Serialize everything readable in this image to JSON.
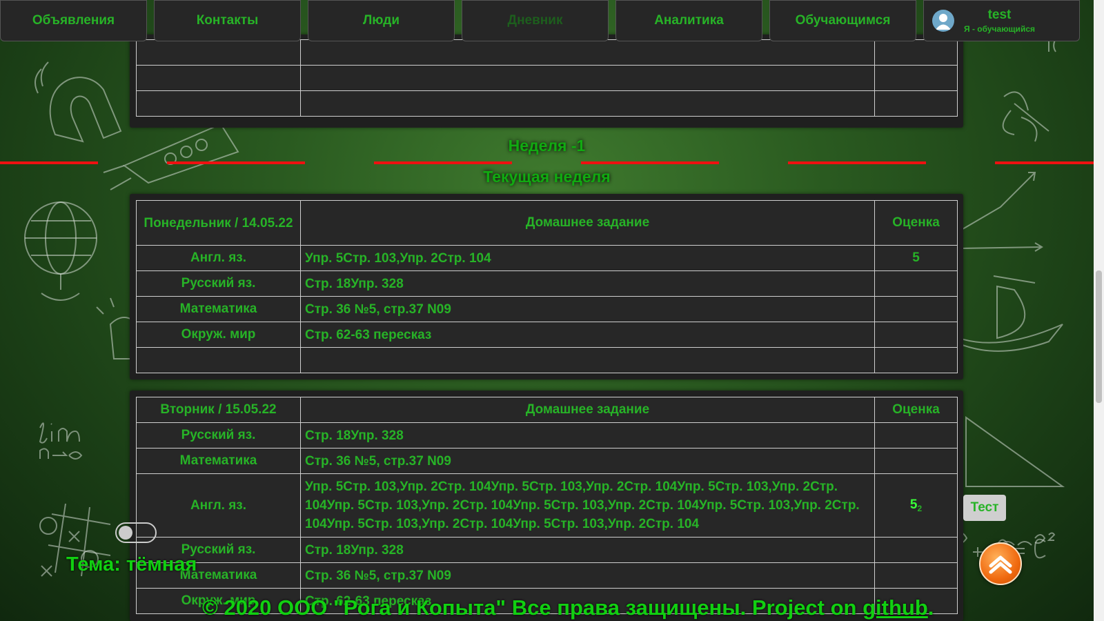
{
  "nav": {
    "items": [
      {
        "label": "Объявления"
      },
      {
        "label": "Контакты"
      },
      {
        "label": "Люди"
      },
      {
        "label": "Дневник",
        "active": true
      },
      {
        "label": "Аналитика"
      },
      {
        "label": "Обучающимся"
      }
    ],
    "user": {
      "name": "test",
      "role": "Я - обучающийся"
    }
  },
  "week": {
    "prev_title": "Неделя -1",
    "current_title": "Текущая неделя"
  },
  "monday": {
    "day_header": "Понедельник / 14.05.22",
    "hw_header": "Домашнее задание",
    "grade_header": "Оценка",
    "rows": [
      {
        "subject": "Англ. яз.",
        "homework": "Упр. 5Стр. 103,Упр. 2Стр. 104",
        "grade": "5"
      },
      {
        "subject": "Русский яз.",
        "homework": "Стр. 18Упр. 328",
        "grade": ""
      },
      {
        "subject": "Математика",
        "homework": "Стр. 36 №5, стр.37 N09",
        "grade": ""
      },
      {
        "subject": "Окруж. мир",
        "homework": "Стр. 62-63 пересказ",
        "grade": ""
      },
      {
        "subject": "",
        "homework": "",
        "grade": ""
      }
    ]
  },
  "tuesday": {
    "day_header": "Вторник / 15.05.22",
    "hw_header": "Домашнее задание",
    "grade_header": "Оценка",
    "rows": [
      {
        "subject": "Русский яз.",
        "homework": "Стр. 18Упр. 328",
        "grade": ""
      },
      {
        "subject": "Математика",
        "homework": "Стр. 36 №5, стр.37 N09",
        "grade": ""
      },
      {
        "subject": "Англ. яз.",
        "homework": "Упр. 5Стр. 103,Упр. 2Стр. 104Упр. 5Стр. 103,Упр. 2Стр. 104Упр. 5Стр. 103,Упр. 2Стр. 104Упр. 5Стр. 103,Упр. 2Стр. 104Упр. 5Стр. 103,Упр. 2Стр. 104Упр. 5Стр. 103,Упр. 2Стр. 104Упр. 5Стр. 103,Упр. 2Стр. 104Упр. 5Стр. 103,Упр. 2Стр. 104",
        "grade": "5",
        "grade_sub": "2"
      },
      {
        "subject": "Русский яз.",
        "homework": "Стр. 18Упр. 328",
        "grade": ""
      },
      {
        "subject": "Математика",
        "homework": "Стр. 36 №5, стр.37 N09",
        "grade": ""
      },
      {
        "subject": "Окруж. мир",
        "homework": "Стр. 62-63 пересказ",
        "grade": ""
      }
    ]
  },
  "theme": {
    "label": "Тема: тёмная"
  },
  "test_button": {
    "label": "Тест"
  },
  "footer": {
    "text": "© 2020 ООО \"Рога и Копыта\" Все права защищены. Project on ",
    "link": "github",
    "end": "."
  }
}
